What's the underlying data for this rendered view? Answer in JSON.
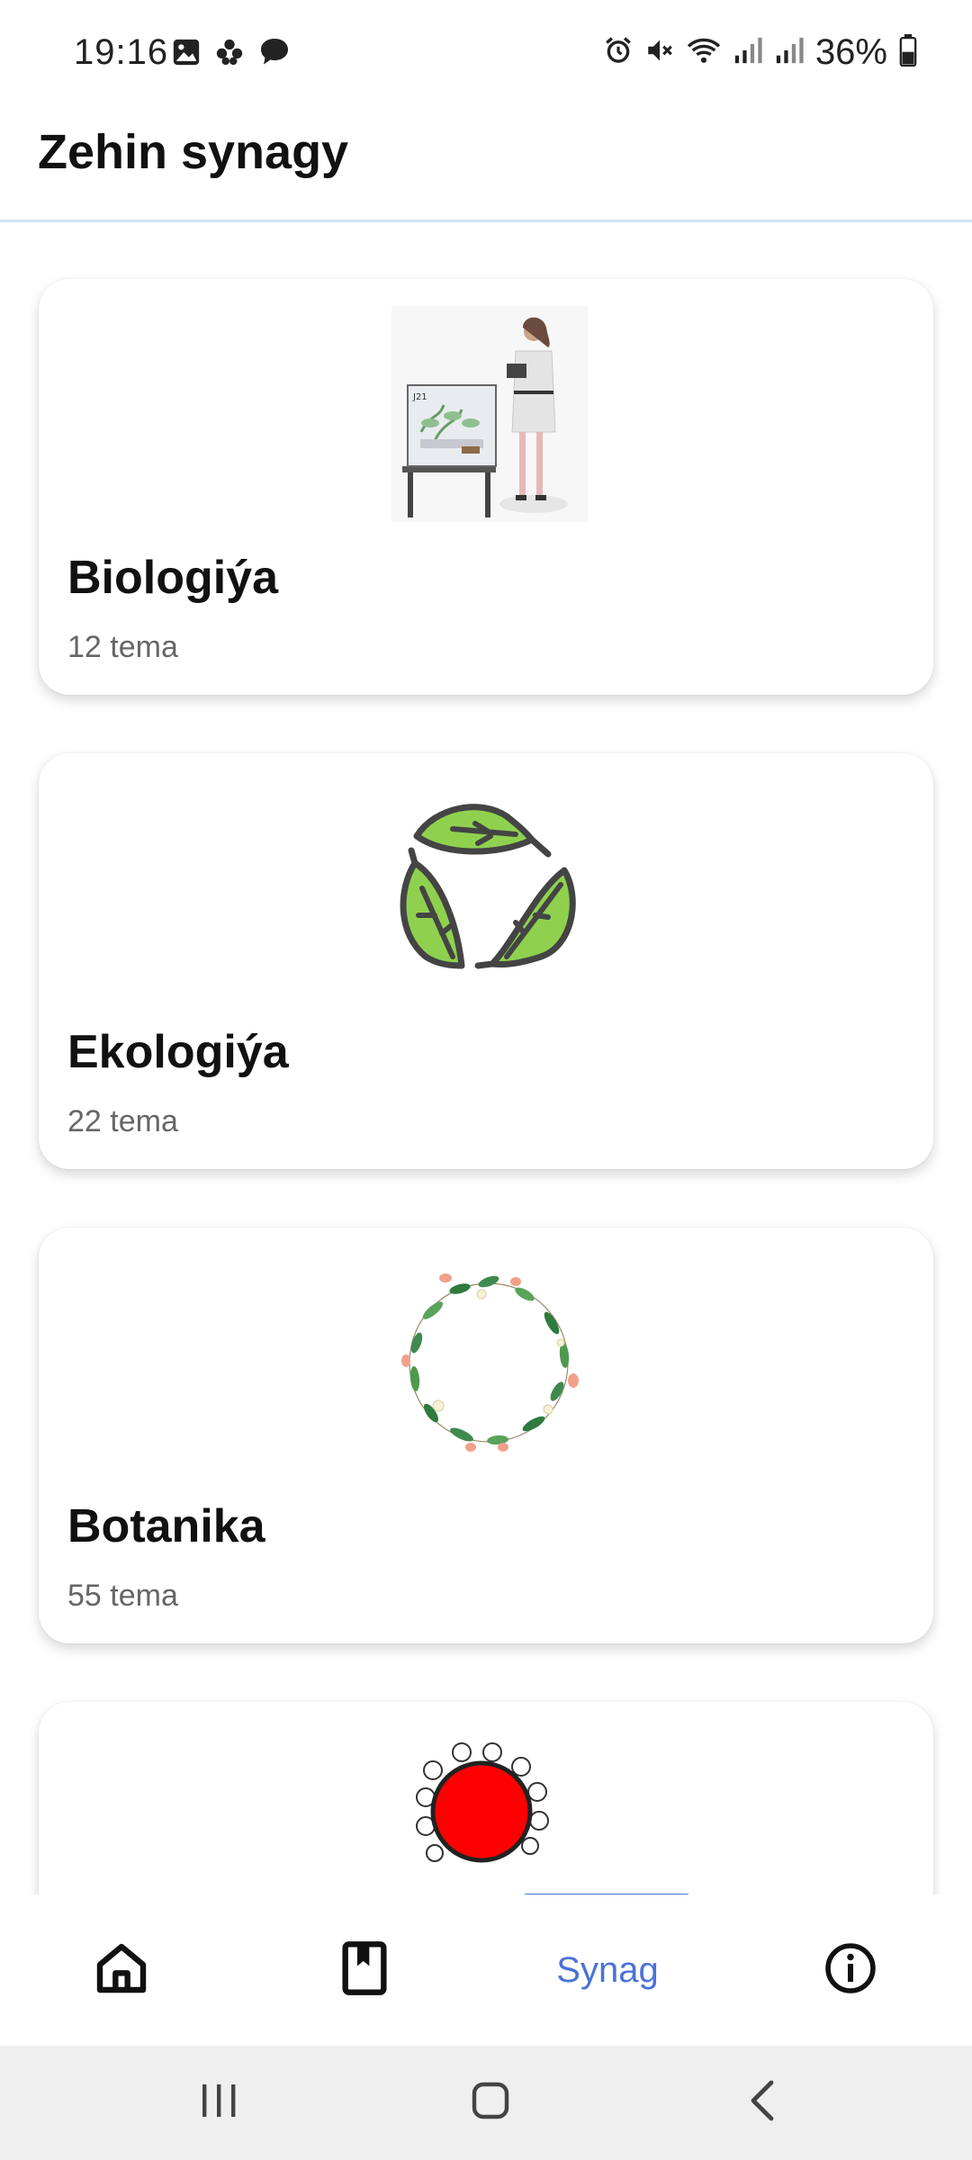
{
  "status_bar": {
    "time": "19:16",
    "battery": "36%",
    "icons": [
      "image-icon",
      "flower-icon",
      "chat-icon",
      "alarm-icon",
      "mute-icon",
      "wifi-icon",
      "signal-icon",
      "signal-icon",
      "battery-icon"
    ]
  },
  "header": {
    "title": "Zehin synagy"
  },
  "cards": [
    {
      "title": "Biologiýa",
      "subtitle": "12 tema",
      "icon": "scientist-illustration"
    },
    {
      "title": "Ekologiýa",
      "subtitle": "22 tema",
      "icon": "leaves-recycle-icon"
    },
    {
      "title": "Botanika",
      "subtitle": "55 tema",
      "icon": "flower-wreath-icon"
    },
    {
      "title": "",
      "subtitle": "",
      "icon": "cell-illustration"
    }
  ],
  "bottom_nav": {
    "items": [
      {
        "icon": "home-icon",
        "label": ""
      },
      {
        "icon": "bookmark-book-icon",
        "label": ""
      },
      {
        "icon": "",
        "label": "Synag"
      },
      {
        "icon": "info-icon",
        "label": ""
      }
    ],
    "active_index": 2,
    "accent_color": "#4a72d8"
  },
  "system_nav": {
    "buttons": [
      "recents-icon",
      "home-circle-icon",
      "back-icon"
    ]
  }
}
